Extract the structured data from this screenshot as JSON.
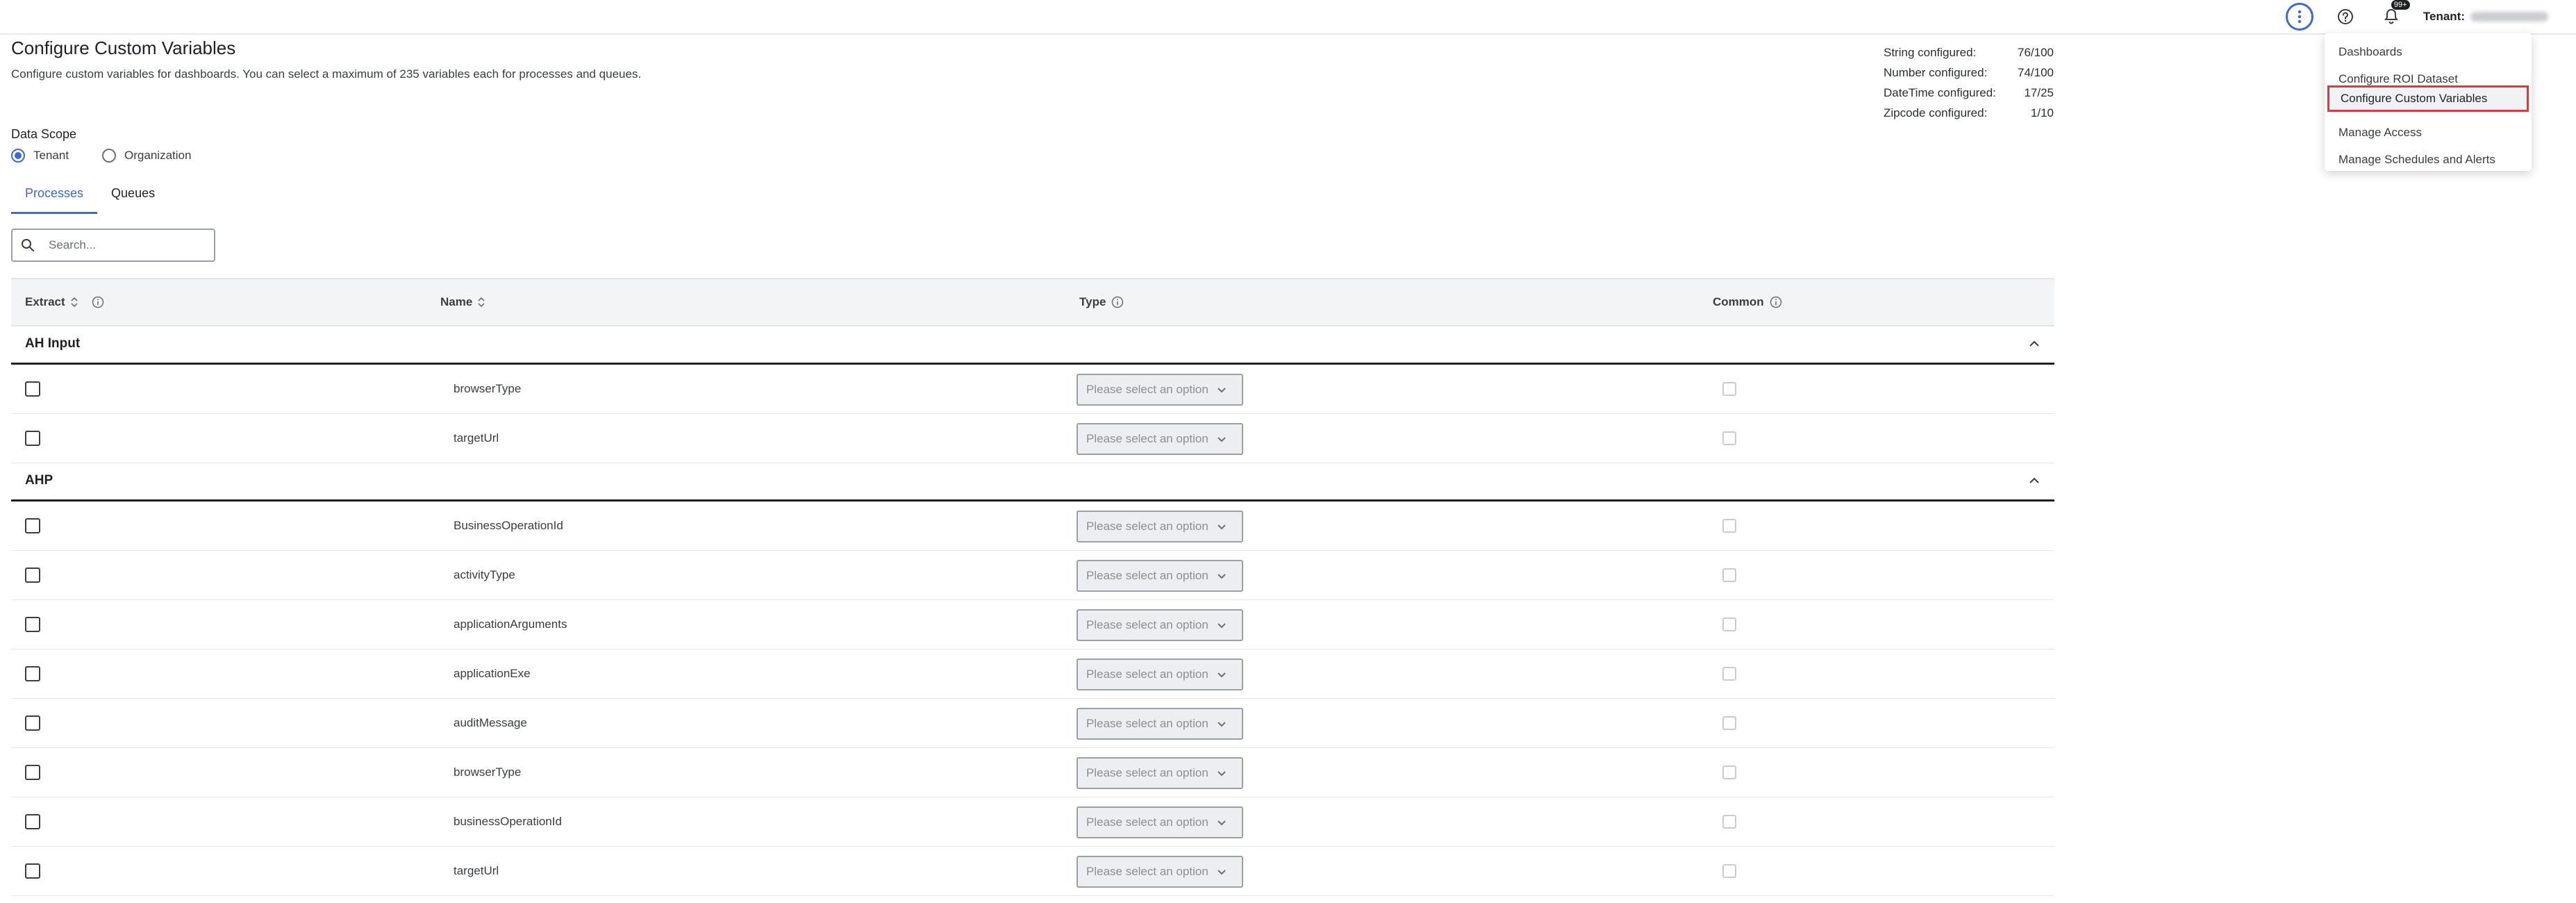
{
  "header": {
    "title": "Configure Custom Variables",
    "subtitle": "Configure custom variables for dashboards. You can select a maximum of 235 variables each for processes and queues.",
    "tenant_label": "Tenant:",
    "notification_badge": "99+"
  },
  "stats": [
    {
      "label": "String configured:",
      "value": "76/100"
    },
    {
      "label": "Number configured:",
      "value": "74/100"
    },
    {
      "label": "DateTime configured:",
      "value": "17/25"
    },
    {
      "label": "Zipcode configured:",
      "value": "1/10"
    }
  ],
  "data_scope": {
    "label": "Data Scope",
    "options": [
      "Tenant",
      "Organization"
    ],
    "selected": "Tenant"
  },
  "tabs": [
    "Processes",
    "Queues"
  ],
  "active_tab": "Processes",
  "search": {
    "placeholder": "Search..."
  },
  "table": {
    "headers": {
      "extract": "Extract",
      "name": "Name",
      "type": "Type",
      "common": "Common"
    },
    "select_placeholder": "Please select an option",
    "groups": [
      {
        "title": "AH Input",
        "rows": [
          "browserType",
          "targetUrl"
        ]
      },
      {
        "title": "AHP",
        "rows": [
          "BusinessOperationId",
          "activityType",
          "applicationArguments",
          "applicationExe",
          "auditMessage",
          "browserType",
          "businessOperationId",
          "targetUrl"
        ]
      }
    ]
  },
  "menu": {
    "items": [
      "Dashboards",
      "Configure ROI Dataset",
      "Configure Custom Variables",
      "Manage Access",
      "Manage Schedules and Alerts"
    ],
    "highlighted": "Configure Custom Variables"
  },
  "colors": {
    "accent": "#3b6ad8",
    "highlight_border": "#d93a3a"
  }
}
